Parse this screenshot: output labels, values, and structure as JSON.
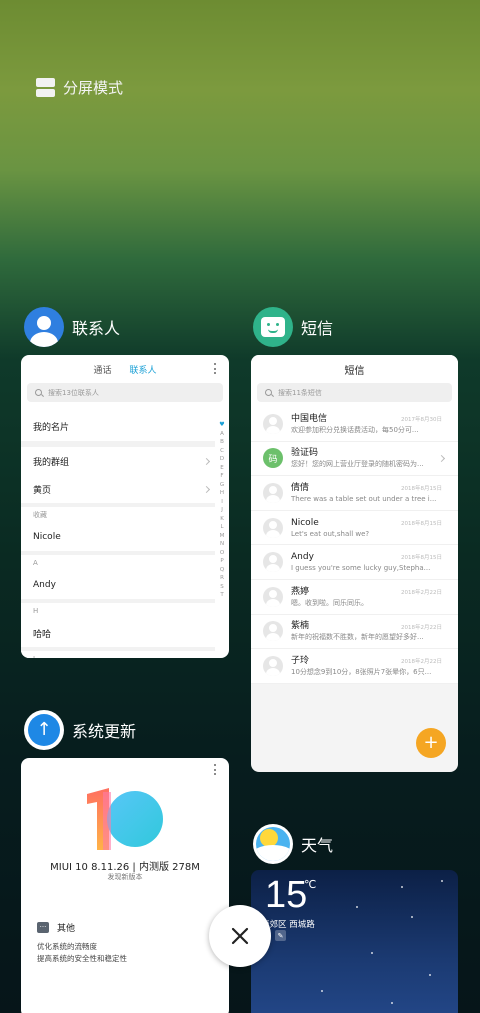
{
  "split_mode": {
    "label": "分屏模式"
  },
  "apps": [
    {
      "name": "联系人",
      "icon": "contacts-icon"
    },
    {
      "name": "短信",
      "icon": "messages-icon"
    },
    {
      "name": "系统更新",
      "icon": "update-icon"
    },
    {
      "name": "天气",
      "icon": "weather-icon"
    }
  ],
  "contacts": {
    "tabs": [
      "通话",
      "联系人"
    ],
    "active_tab": "联系人",
    "search_placeholder": "搜索13位联系人",
    "my_card": "我的名片",
    "my_groups": "我的群组",
    "yellow_pages": "黄页",
    "section_favorites": "收藏",
    "favorite": "Nicole",
    "section_a": "A",
    "contact_a": "Andy",
    "section_h": "H",
    "contact_h": "哈哈",
    "section_j": "J",
    "index": [
      "A",
      "B",
      "C",
      "D",
      "E",
      "F",
      "G",
      "H",
      "I",
      "J",
      "K",
      "L",
      "M",
      "N",
      "O",
      "P",
      "Q",
      "R",
      "S",
      "T"
    ]
  },
  "messages": {
    "title": "短信",
    "search_placeholder": "搜索11条短信",
    "items": [
      {
        "name": "中国电信",
        "preview": "欢迎参加积分兑换话费活动，每50分可...",
        "date": "2017年8月30日"
      },
      {
        "name": "验证码",
        "preview": "您好！您的网上营业厅登录的随机密码为...",
        "date": ""
      },
      {
        "name": "倩倩",
        "preview": "There was a table set out under a tree i...",
        "date": "2018年8月15日"
      },
      {
        "name": "Nicole",
        "preview": "Let's eat out,shall we?",
        "date": "2018年8月15日"
      },
      {
        "name": "Andy",
        "preview": "I guess you're some lucky guy,Stepha...",
        "date": "2018年8月15日"
      },
      {
        "name": "燕婷",
        "preview": "嗯。收到啦。同乐同乐。",
        "date": "2018年2月22日"
      },
      {
        "name": "紫楠",
        "preview": "新年的祝福数不胜数，新年的愿望好多好...",
        "date": "2018年2月22日"
      },
      {
        "name": "子玲",
        "preview": "10分想念9到10分，8张照片7张晕你，6只...",
        "date": "2018年2月22日"
      }
    ],
    "verify_avatar": "码",
    "fab": "+"
  },
  "update": {
    "version": "MIUI 10 8.11.26 | 内测版 278M",
    "note": "发现新版本",
    "other_label": "其他",
    "other_icon": "···",
    "lines": [
      "优化系统的流畅度",
      "提高系统的安全性和稳定性"
    ]
  },
  "weather": {
    "temp": "15",
    "unit": "℃",
    "location": "奎郊区  西城路",
    "edit_icon": "✎"
  },
  "close": {
    "label": "✕"
  }
}
